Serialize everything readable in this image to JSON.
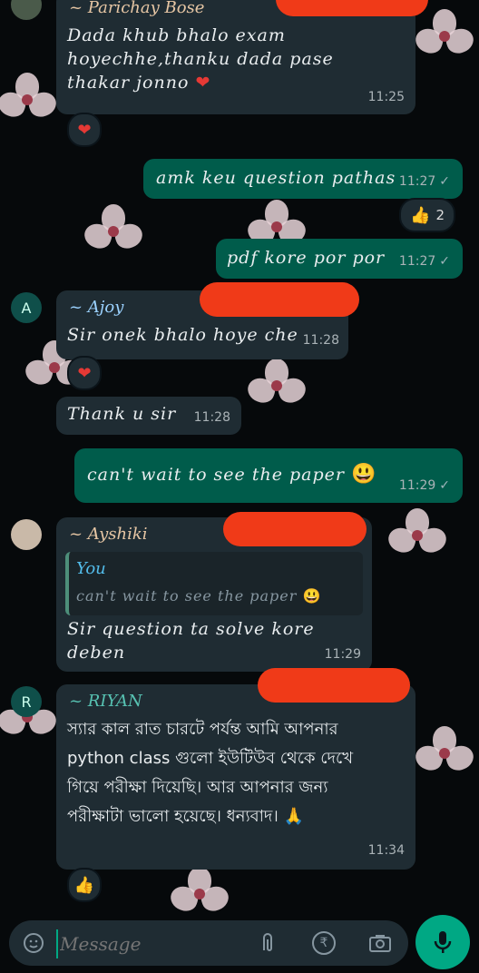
{
  "messages": {
    "m1": {
      "sender": "~ Parichay Bose",
      "text": "Dada khub bhalo exam hoyechhe,thanku dada pase thakar jonno",
      "time": "11:25"
    },
    "m2": {
      "text": "amk keu question pathas",
      "time": "11:27"
    },
    "m2_reaction": {
      "count": "2"
    },
    "m3": {
      "text": "pdf kore por por",
      "time": "11:27"
    },
    "m4": {
      "sender": "~ Ajoy",
      "avatar": "A",
      "text": "Sir onek bhalo hoye che",
      "time": "11:28"
    },
    "m5": {
      "text": "Thank u sir",
      "time": "11:28"
    },
    "m6": {
      "text": "can't wait to see the paper",
      "time": "11:29"
    },
    "m7": {
      "sender": "~ Ayshiki",
      "quote_author": "You",
      "quote_text": "can't wait to see the paper",
      "text": "Sir question ta solve kore deben",
      "time": "11:29"
    },
    "m8": {
      "sender": "~ RIYAN",
      "avatar": "R",
      "text": "স্যার কাল রাত চারটে পর্যন্ত আমি আপনার python class গুলো ইউটিউব থেকে দেখে গিয়ে পরীক্ষা দিয়েছি। আর আপনার জন্য পরীক্ষাটা ভালো হয়েছে। ধন্যবাদ।",
      "time": "11:34"
    }
  },
  "composer": {
    "placeholder": "Message"
  },
  "icons": {
    "check": "✓",
    "heart": "❤",
    "thumbs": "👍",
    "grin": "😃",
    "pray": "🙏",
    "rupee": "₹"
  }
}
